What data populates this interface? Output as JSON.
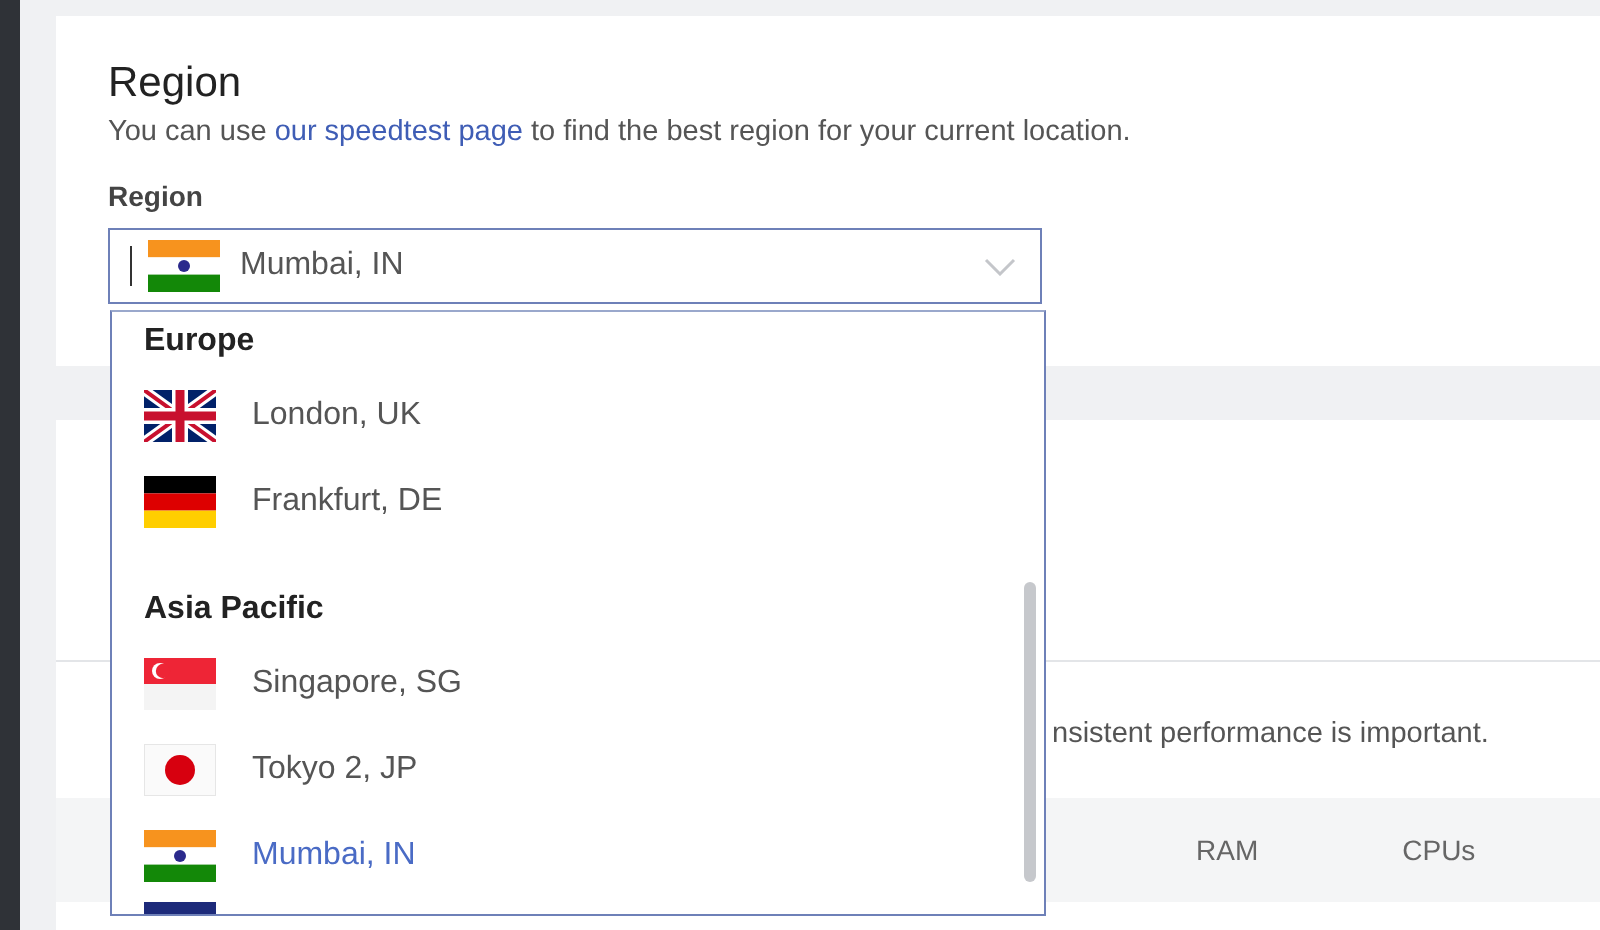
{
  "region_card": {
    "title": "Region",
    "description_before": "You can use ",
    "link": "our speedtest page",
    "description_after": " to find the best region for your current location.",
    "field_label": "Region",
    "select": {
      "value": "Mumbai, IN",
      "kind": "in",
      "expanded": true
    }
  },
  "dropdown": {
    "groups": [
      {
        "heading": "Europe",
        "items": [
          {
            "label": "London, UK",
            "kind": "uk",
            "selected": false
          },
          {
            "label": "Frankfurt, DE",
            "kind": "de",
            "selected": false
          }
        ]
      },
      {
        "heading": "Asia Pacific",
        "items": [
          {
            "label": "Singapore, SG",
            "kind": "sg",
            "selected": false
          },
          {
            "label": "Tokyo 2, JP",
            "kind": "jp",
            "selected": false
          },
          {
            "label": "Mumbai, IN",
            "kind": "in",
            "selected": true
          }
        ]
      }
    ]
  },
  "plan_card": {
    "description": "nsistent performance is important.",
    "columns": [
      "RAM",
      "CPUs"
    ]
  }
}
